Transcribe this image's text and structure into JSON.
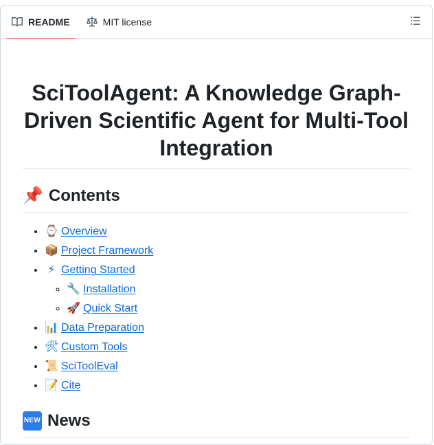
{
  "tabs": [
    {
      "label": "README",
      "icon": "book-icon",
      "active": true
    },
    {
      "label": "MIT license",
      "icon": "scale-icon",
      "active": false
    }
  ],
  "outline_icon": "list-unordered-icon",
  "readme": {
    "title": "SciToolAgent: A Knowledge Graph-Driven Scientific Agent for Multi-Tool Integration",
    "contents_heading": {
      "emoji": "📌",
      "text": "Contents"
    },
    "toc": [
      {
        "emoji": "⌚",
        "label": "Overview"
      },
      {
        "emoji": "📦",
        "label": "Project Framework"
      },
      {
        "emoji": "⚡",
        "label": "Getting Started",
        "children": [
          {
            "emoji": "🔧",
            "label": "Installation"
          },
          {
            "emoji": "🚀",
            "label": "Quick Start"
          }
        ]
      },
      {
        "emoji": "📊",
        "label": "Data Preparation"
      },
      {
        "emoji": "🛠",
        "label": "Custom Tools"
      },
      {
        "emoji": "📜",
        "label": "SciToolEval"
      },
      {
        "emoji": "📝",
        "label": "Cite"
      }
    ],
    "news_heading": {
      "emoji": "NEW",
      "text": "News"
    }
  },
  "colors": {
    "link": "#0969da",
    "active_tab_underline": "#fd8c73",
    "border": "#d0d7de"
  }
}
